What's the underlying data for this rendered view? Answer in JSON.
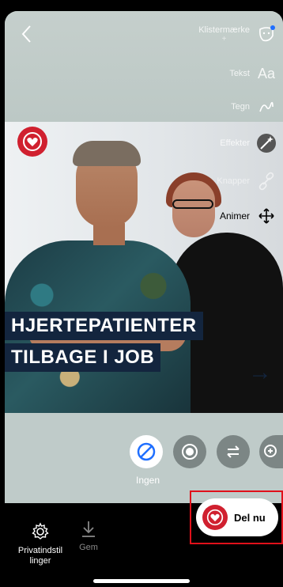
{
  "canvas": {
    "headline_line1": "HJERTEPATIENTER",
    "headline_line2": "TILBAGE I JOB"
  },
  "toolbar": {
    "sticker_label": "Klistermærke",
    "sticker_sub": "+",
    "text_label": "Tekst",
    "text_icon": "Aa",
    "draw_label": "Tegn",
    "effects_label": "Effekter",
    "buttons_label": "Knapper",
    "animate_label": "Animer"
  },
  "effects": {
    "none_label": "Ingen"
  },
  "bottom": {
    "privacy_label_line1": "Privatindstil",
    "privacy_label_line2": "linger",
    "save_label": "Gem",
    "share_label": "Del nu"
  },
  "colors": {
    "brand_red": "#d0202f",
    "headline_bg": "#13253e",
    "highlight_frame": "#e0101a"
  }
}
